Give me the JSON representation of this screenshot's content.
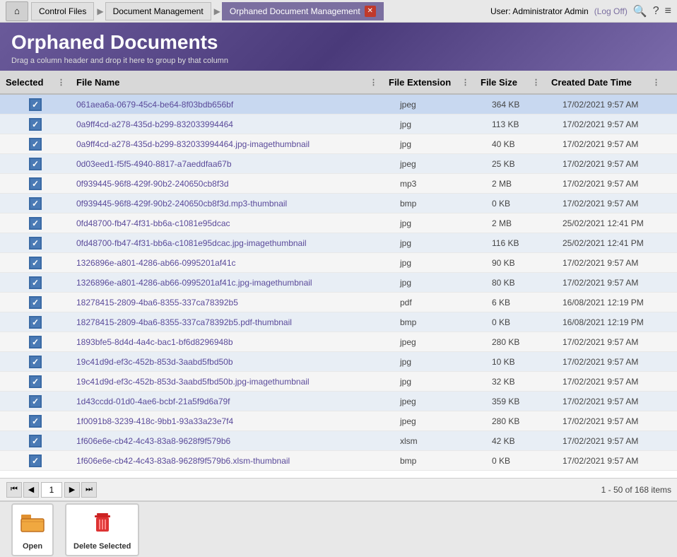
{
  "nav": {
    "home_icon": "⌂",
    "crumbs": [
      {
        "label": "Control Files",
        "active": false
      },
      {
        "label": "Document Management",
        "active": false
      },
      {
        "label": "Orphaned Document Management",
        "active": true
      }
    ],
    "user_text": "User: Administrator Admin",
    "logoff_text": "(Log Off)",
    "search_icon": "🔍",
    "help_icon": "?",
    "menu_icon": "≡"
  },
  "page": {
    "title": "Orphaned Documents",
    "drag_hint": "Drag a column header and drop it here to group by that column"
  },
  "table": {
    "columns": [
      {
        "label": "Selected",
        "id": "selected"
      },
      {
        "label": "File Name",
        "id": "filename"
      },
      {
        "label": "File Extension",
        "id": "ext"
      },
      {
        "label": "File Size",
        "id": "size"
      },
      {
        "label": "Created Date Time",
        "id": "date"
      }
    ],
    "rows": [
      {
        "filename": "061aea6a-0679-45c4-be64-8f03bdb656bf",
        "ext": "jpeg",
        "size": "364 KB",
        "date": "17/02/2021 9:57 AM",
        "checked": true
      },
      {
        "filename": "0a9ff4cd-a278-435d-b299-832033994464",
        "ext": "jpg",
        "size": "113 KB",
        "date": "17/02/2021 9:57 AM",
        "checked": true
      },
      {
        "filename": "0a9ff4cd-a278-435d-b299-832033994464.jpg-imagethumbnail",
        "ext": "jpg",
        "size": "40 KB",
        "date": "17/02/2021 9:57 AM",
        "checked": true
      },
      {
        "filename": "0d03eed1-f5f5-4940-8817-a7aeddfaa67b",
        "ext": "jpeg",
        "size": "25 KB",
        "date": "17/02/2021 9:57 AM",
        "checked": true
      },
      {
        "filename": "0f939445-96f8-429f-90b2-240650cb8f3d",
        "ext": "mp3",
        "size": "2 MB",
        "date": "17/02/2021 9:57 AM",
        "checked": true
      },
      {
        "filename": "0f939445-96f8-429f-90b2-240650cb8f3d.mp3-thumbnail",
        "ext": "bmp",
        "size": "0 KB",
        "date": "17/02/2021 9:57 AM",
        "checked": true
      },
      {
        "filename": "0fd48700-fb47-4f31-bb6a-c1081e95dcac",
        "ext": "jpg",
        "size": "2 MB",
        "date": "25/02/2021 12:41 PM",
        "checked": true
      },
      {
        "filename": "0fd48700-fb47-4f31-bb6a-c1081e95dcac.jpg-imagethumbnail",
        "ext": "jpg",
        "size": "116 KB",
        "date": "25/02/2021 12:41 PM",
        "checked": true
      },
      {
        "filename": "1326896e-a801-4286-ab66-0995201af41c",
        "ext": "jpg",
        "size": "90 KB",
        "date": "17/02/2021 9:57 AM",
        "checked": true
      },
      {
        "filename": "1326896e-a801-4286-ab66-0995201af41c.jpg-imagethumbnail",
        "ext": "jpg",
        "size": "80 KB",
        "date": "17/02/2021 9:57 AM",
        "checked": true
      },
      {
        "filename": "18278415-2809-4ba6-8355-337ca78392b5",
        "ext": "pdf",
        "size": "6 KB",
        "date": "16/08/2021 12:19 PM",
        "checked": true
      },
      {
        "filename": "18278415-2809-4ba6-8355-337ca78392b5.pdf-thumbnail",
        "ext": "bmp",
        "size": "0 KB",
        "date": "16/08/2021 12:19 PM",
        "checked": true
      },
      {
        "filename": "1893bfe5-8d4d-4a4c-bac1-bf6d8296948b",
        "ext": "jpeg",
        "size": "280 KB",
        "date": "17/02/2021 9:57 AM",
        "checked": true
      },
      {
        "filename": "19c41d9d-ef3c-452b-853d-3aabd5fbd50b",
        "ext": "jpg",
        "size": "10 KB",
        "date": "17/02/2021 9:57 AM",
        "checked": true
      },
      {
        "filename": "19c41d9d-ef3c-452b-853d-3aabd5fbd50b.jpg-imagethumbnail",
        "ext": "jpg",
        "size": "32 KB",
        "date": "17/02/2021 9:57 AM",
        "checked": true
      },
      {
        "filename": "1d43ccdd-01d0-4ae6-bcbf-21a5f9d6a79f",
        "ext": "jpeg",
        "size": "359 KB",
        "date": "17/02/2021 9:57 AM",
        "checked": true
      },
      {
        "filename": "1f0091b8-3239-418c-9bb1-93a33a23e7f4",
        "ext": "jpeg",
        "size": "280 KB",
        "date": "17/02/2021 9:57 AM",
        "checked": true
      },
      {
        "filename": "1f606e6e-cb42-4c43-83a8-9628f9f579b6",
        "ext": "xlsm",
        "size": "42 KB",
        "date": "17/02/2021 9:57 AM",
        "checked": true
      },
      {
        "filename": "1f606e6e-cb42-4c43-83a8-9628f9f579b6.xlsm-thumbnail",
        "ext": "bmp",
        "size": "0 KB",
        "date": "17/02/2021 9:57 AM",
        "checked": true
      }
    ]
  },
  "pagination": {
    "current_page": "1",
    "first_icon": "⏮",
    "prev_icon": "◀",
    "next_icon": "▶",
    "last_icon": "⏭",
    "info": "1 - 50 of 168 items"
  },
  "toolbar": {
    "open_label": "Open",
    "delete_label": "Delete Selected",
    "open_icon": "📂",
    "delete_icon": "🗑"
  }
}
